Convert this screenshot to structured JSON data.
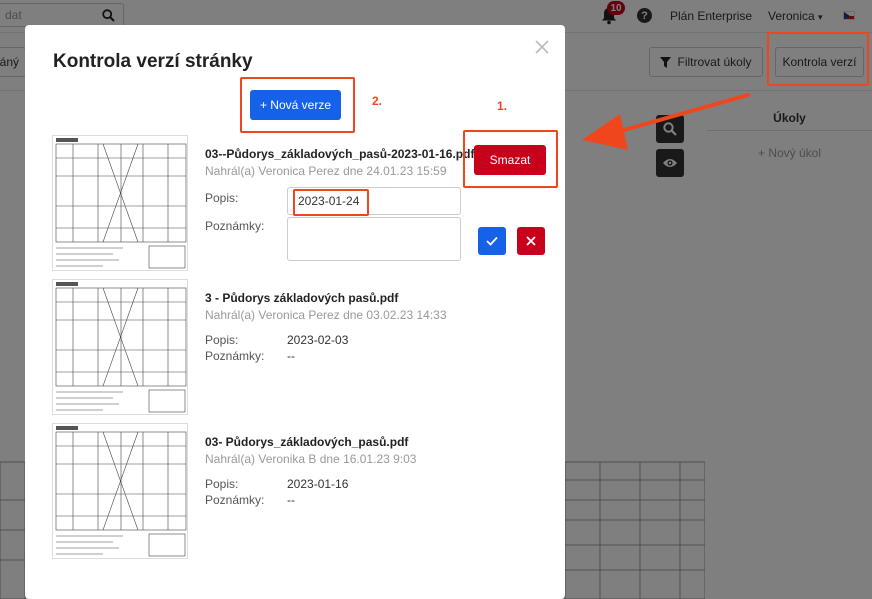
{
  "topbar": {
    "search_placeholder": "dat",
    "notifications_count": "10",
    "help_label": "?",
    "plan_label": "Plán Enterprise",
    "user_name": "Veronica",
    "user_caret": "▾"
  },
  "toolbar": {
    "plany_label": "pláný",
    "filter_label": "Filtrovat úkoly",
    "kontrola_label": "Kontrola verzí"
  },
  "tasks": {
    "header": "Úkoly",
    "add_label": "+ Nový úkol"
  },
  "modal": {
    "title": "Kontrola verzí stránky",
    "new_version_label": "+ Nová verze",
    "delete_label": "Smazat",
    "desc_label": "Popis:",
    "notes_label": "Poznámky:",
    "versions": [
      {
        "filename": "03--Půdorys_základových_pasů-2023-01-16.pdf",
        "uploaded": "Nahrál(a) Veronica Perez dne 24.01.23 15:59",
        "description": "2023-01-24",
        "notes": ""
      },
      {
        "filename": "3 - Půdorys základových pasů.pdf",
        "uploaded": "Nahrál(a) Veronica Perez dne 03.02.23 14:33",
        "description": "2023-02-03",
        "notes": "--"
      },
      {
        "filename": "03- Půdorys_základových_pasů.pdf",
        "uploaded": "Nahrál(a) Veronika B dne 16.01.23 9:03",
        "description": "2023-01-16",
        "notes": "--"
      }
    ]
  },
  "annotations": {
    "step1": "1.",
    "step2": "2.",
    "color": "#f0461e"
  },
  "colors": {
    "primary": "#1561e8",
    "danger": "#c9001b",
    "annotation": "#f0461e"
  }
}
